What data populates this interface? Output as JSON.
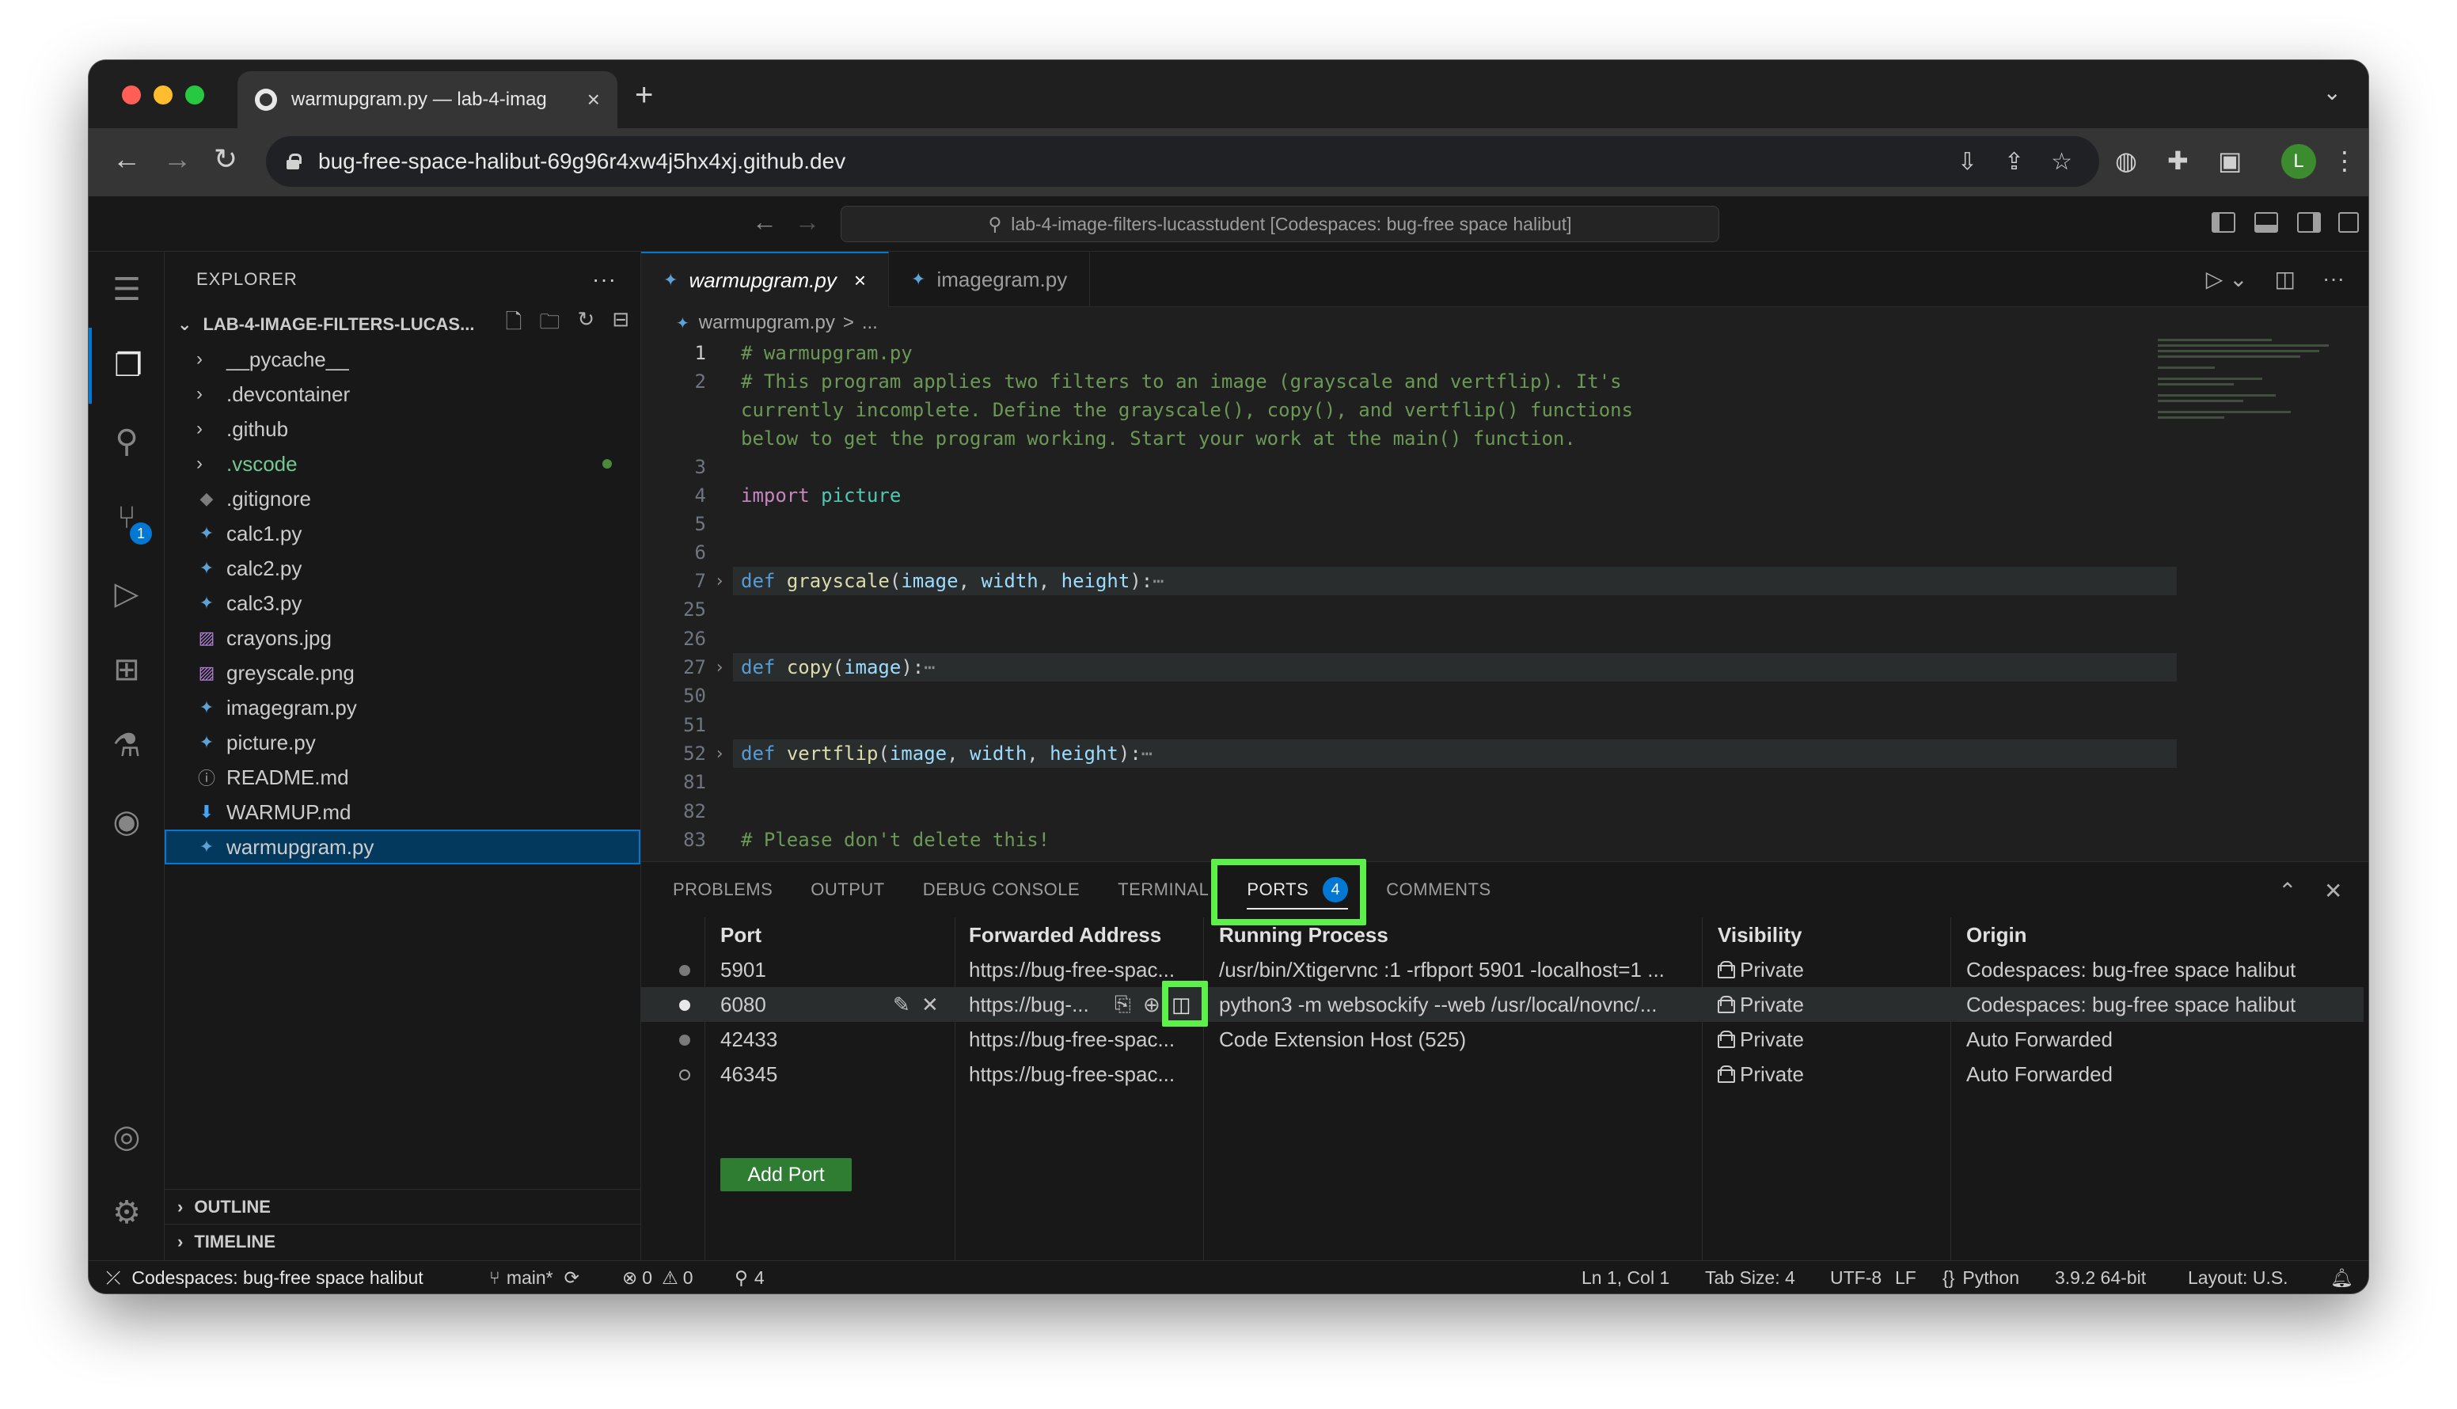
{
  "browser": {
    "tab_title": "warmupgram.py — lab-4-imag",
    "tab_close": "×",
    "new_tab": "+",
    "tab_dropdown": "⌄",
    "url": "bug-free-space-halibut-69g96r4xw4j5hx4xj.github.dev",
    "profile_initial": "L",
    "nav": {
      "back": "←",
      "forward": "→",
      "reload": "↻"
    }
  },
  "vscode": {
    "command_center": "lab-4-image-filters-lucasstudent [Codespaces: bug-free space halibut]",
    "title_nav": {
      "back": "←",
      "forward": "→"
    }
  },
  "activity_bar": {
    "scm_badge": "1"
  },
  "explorer": {
    "header": "EXPLORER",
    "more": "···",
    "folder": "LAB-4-IMAGE-FILTERS-LUCAS...",
    "items": [
      {
        "label": "__pycache__",
        "kind": "folder"
      },
      {
        "label": ".devcontainer",
        "kind": "folder"
      },
      {
        "label": ".github",
        "kind": "folder"
      },
      {
        "label": ".vscode",
        "kind": "folder"
      },
      {
        "label": ".gitignore",
        "kind": "git"
      },
      {
        "label": "calc1.py",
        "kind": "py"
      },
      {
        "label": "calc2.py",
        "kind": "py"
      },
      {
        "label": "calc3.py",
        "kind": "py"
      },
      {
        "label": "crayons.jpg",
        "kind": "img"
      },
      {
        "label": "greyscale.png",
        "kind": "img"
      },
      {
        "label": "imagegram.py",
        "kind": "py"
      },
      {
        "label": "picture.py",
        "kind": "py"
      },
      {
        "label": "README.md",
        "kind": "info"
      },
      {
        "label": "WARMUP.md",
        "kind": "md"
      },
      {
        "label": "warmupgram.py",
        "kind": "py"
      }
    ],
    "outline": "OUTLINE",
    "timeline": "TIMELINE"
  },
  "editor": {
    "tabs": [
      {
        "label": "warmupgram.py",
        "active": true,
        "close": "×"
      },
      {
        "label": "imagegram.py",
        "active": false
      }
    ],
    "breadcrumb_file": "warmupgram.py",
    "breadcrumb_sep": ">",
    "breadcrumb_more": "...",
    "lines": {
      "l1_num": "1",
      "l1": "# warmupgram.py",
      "l2_num": "2",
      "l2a": "# This program applies two filters to an image (grayscale and vertflip). It's",
      "l2b": "currently incomplete. Define the grayscale(), copy(), and vertflip() functions",
      "l2c": "below to get the program working. Start your work at the main() function.",
      "l3_num": "3",
      "l4_num": "4",
      "l4_kw": "import",
      "l4_mod": "picture",
      "l5_num": "5",
      "l6_num": "6",
      "l7_num": "7",
      "l7_def": "def",
      "l7_fn": "grayscale",
      "l7_p1": "image",
      "l7_p2": "width",
      "l7_p3": "height",
      "l25_num": "25",
      "l26_num": "26",
      "l27_num": "27",
      "l27_def": "def",
      "l27_fn": "copy",
      "l27_p1": "image",
      "l50_num": "50",
      "l51_num": "51",
      "l52_num": "52",
      "l52_def": "def",
      "l52_fn": "vertflip",
      "l52_p1": "image",
      "l52_p2": "width",
      "l52_p3": "height",
      "l81_num": "81",
      "l82_num": "82",
      "l83_num": "83",
      "l83": "# Please don't delete this!",
      "ellipsis": "⋯"
    }
  },
  "panel": {
    "tabs": [
      "PROBLEMS",
      "OUTPUT",
      "DEBUG CONSOLE",
      "TERMINAL",
      "PORTS",
      "COMMENTS"
    ],
    "ports_count": "4",
    "columns": [
      "Port",
      "Forwarded Address",
      "Running Process",
      "Visibility",
      "Origin"
    ],
    "rows": [
      {
        "port": "5901",
        "address": "https://bug-free-spac...",
        "process": "/usr/bin/Xtigervnc :1 -rfbport 5901 -localhost=1 ...",
        "visibility": "Private",
        "origin": "Codespaces: bug-free space halibut"
      },
      {
        "port": "6080",
        "address": "https://bug-...",
        "process": "python3 -m websockify --web /usr/local/novnc/...",
        "visibility": "Private",
        "origin": "Codespaces: bug-free space halibut"
      },
      {
        "port": "42433",
        "address": "https://bug-free-spac...",
        "process": "Code Extension Host (525)",
        "visibility": "Private",
        "origin": "Auto Forwarded"
      },
      {
        "port": "46345",
        "address": "https://bug-free-spac...",
        "process": "",
        "visibility": "Private",
        "origin": "Auto Forwarded"
      }
    ],
    "add_port": "Add Port"
  },
  "statusbar": {
    "remote": "Codespaces: bug-free space halibut",
    "branch": "main*",
    "errors": "0",
    "warnings": "0",
    "ports": "4",
    "cursor": "Ln 1, Col 1",
    "tab_size": "Tab Size: 4",
    "encoding": "UTF-8",
    "eol": "LF",
    "language": "Python",
    "interpreter": "3.9.2 64-bit",
    "layout": "Layout: U.S."
  },
  "colors": {
    "accent": "#0078d4",
    "highlight_box": "#5ef04a",
    "add_port_button": "#2e7d32"
  }
}
